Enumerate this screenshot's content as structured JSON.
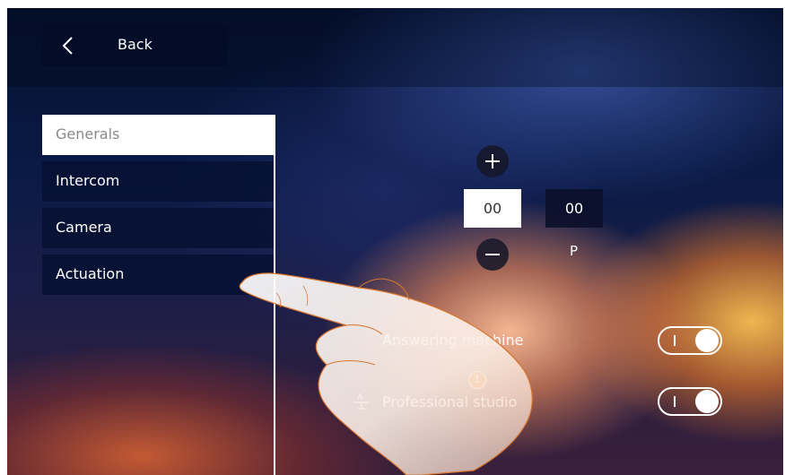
{
  "header": {
    "back_label": "Back"
  },
  "menu": {
    "items": [
      {
        "label": "Generals",
        "active": true
      },
      {
        "label": "Intercom",
        "active": false
      },
      {
        "label": "Camera",
        "active": false
      },
      {
        "label": "Actuation",
        "active": false
      }
    ]
  },
  "address": {
    "selected_value": "00",
    "second_value": "00",
    "p_label": "P"
  },
  "options": [
    {
      "label": "Answering machine",
      "state": "on"
    },
    {
      "label": "Professional studio",
      "state": "on"
    }
  ],
  "icons": {
    "back": "chevron-left-icon",
    "plus": "plus-icon",
    "minus": "minus-icon",
    "studio": "professional-studio-icon"
  },
  "callout": {
    "number": "1"
  },
  "colors": {
    "callout": "#e8780e",
    "highlight": "#ffffff"
  }
}
